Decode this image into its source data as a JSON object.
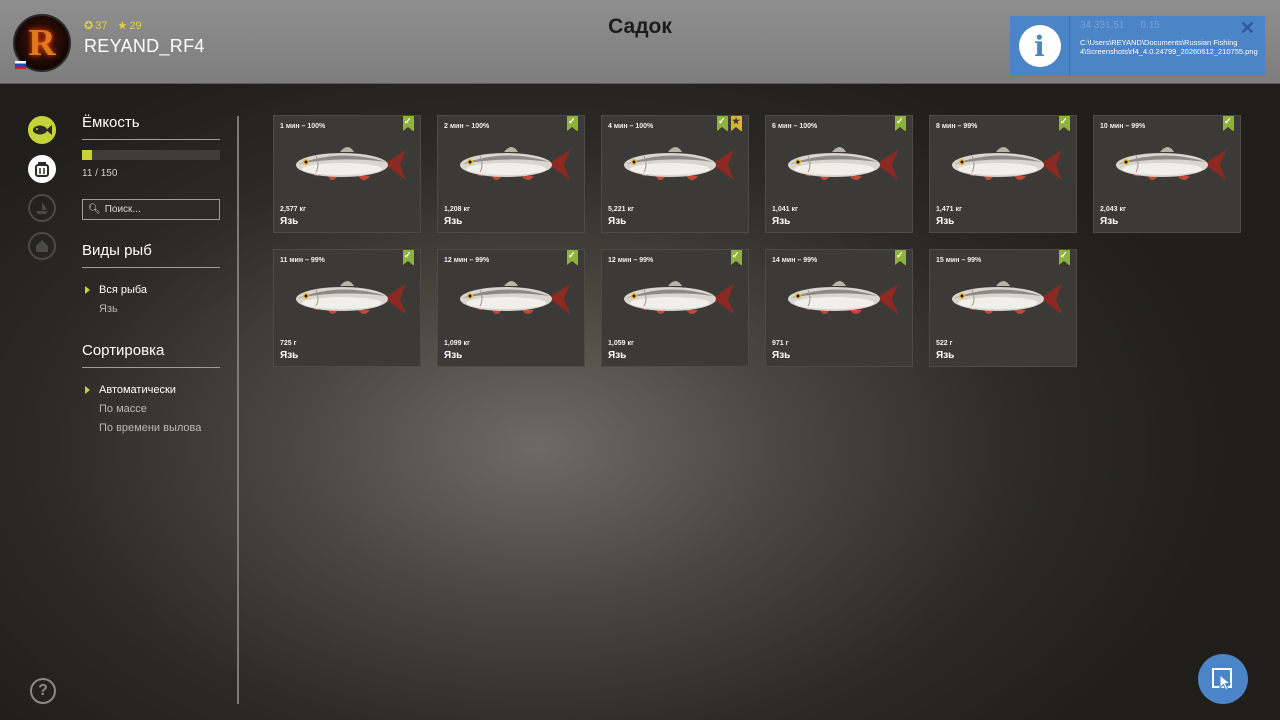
{
  "header": {
    "title": "Садок",
    "username": "REYAND_RF4",
    "avatar_letter": "R",
    "stat_coins": "37",
    "stat_level": "29"
  },
  "notification": {
    "path": "C:\\Users\\REYAND\\Documents\\Russian Fishing 4\\Screenshots\\rf4_4.0.24799_20260612_210755.png",
    "stat_a": "34 331,51",
    "stat_b": "0,15",
    "close": "✕"
  },
  "sidebar": {
    "capacity_title": "Ёмкость",
    "capacity_used": 11,
    "capacity_total": 150,
    "capacity_text": "11 / 150",
    "search_placeholder": "Поиск...",
    "species_title": "Виды рыб",
    "species": [
      {
        "label": "Вся рыба",
        "active": true
      },
      {
        "label": "Язь",
        "active": false
      }
    ],
    "sort_title": "Сортировка",
    "sort_options": [
      {
        "label": "Автоматически",
        "active": true
      },
      {
        "label": "По массе",
        "active": false
      },
      {
        "label": "По времени вылова",
        "active": false
      }
    ]
  },
  "catches": [
    {
      "time": "1 мин – 100%",
      "weight": "2,577 кг",
      "name": "Язь",
      "star": false
    },
    {
      "time": "2 мин – 100%",
      "weight": "1,208 кг",
      "name": "Язь",
      "star": false
    },
    {
      "time": "4 мин – 100%",
      "weight": "5,221 кг",
      "name": "Язь",
      "star": true
    },
    {
      "time": "6 мин – 100%",
      "weight": "1,041 кг",
      "name": "Язь",
      "star": false
    },
    {
      "time": "8 мин – 99%",
      "weight": "1,471 кг",
      "name": "Язь",
      "star": false
    },
    {
      "time": "10 мин – 99%",
      "weight": "2,043 кг",
      "name": "Язь",
      "star": false
    },
    {
      "time": "11 мин – 99%",
      "weight": "725 г",
      "name": "Язь",
      "star": false
    },
    {
      "time": "12 мин – 99%",
      "weight": "1,099 кг",
      "name": "Язь",
      "star": false
    },
    {
      "time": "12 мин – 99%",
      "weight": "1,059 кг",
      "name": "Язь",
      "star": false
    },
    {
      "time": "14 мин – 99%",
      "weight": "971 г",
      "name": "Язь",
      "star": false
    },
    {
      "time": "15 мин – 99%",
      "weight": "522 г",
      "name": "Язь",
      "star": false
    }
  ],
  "icons": {
    "rail": [
      "fish-icon",
      "keepnet-icon",
      "boat-icon",
      "home-icon"
    ],
    "help": "?",
    "accent": "#c6d23a",
    "badge_color": "#8fb23a",
    "star_color": "#d8b52a",
    "notify_color": "#4c84c8"
  }
}
